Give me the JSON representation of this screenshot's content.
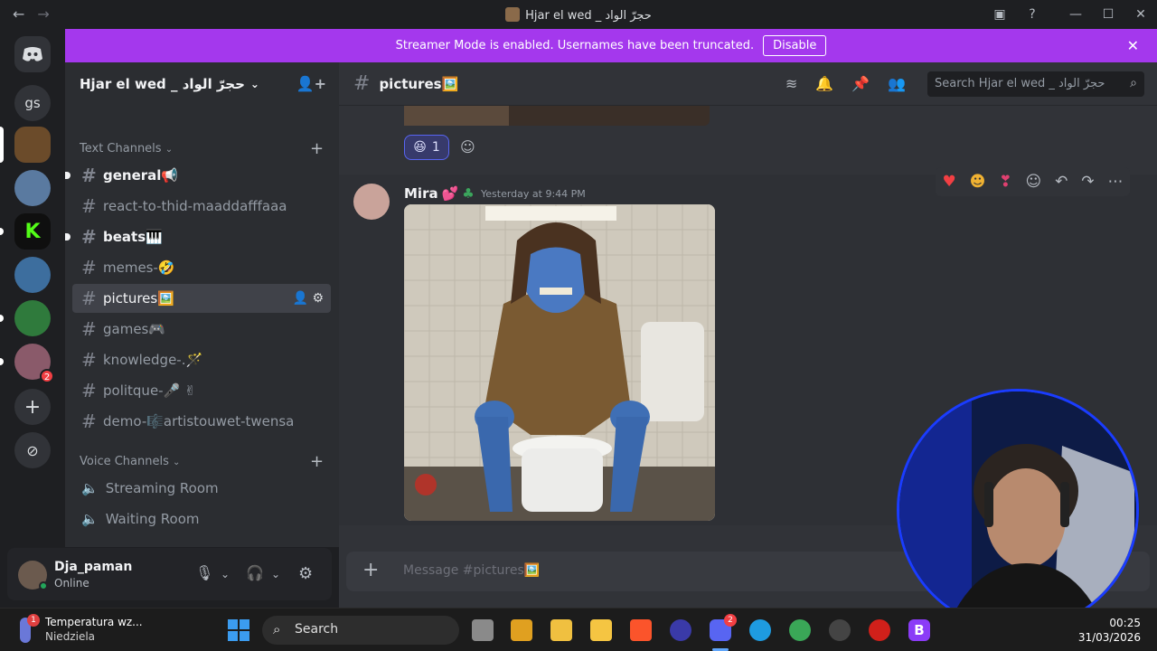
{
  "window": {
    "title": "Hjar el wed _ حجرّ الواد"
  },
  "banner": {
    "text": "Streamer Mode is enabled. Usernames have been truncated.",
    "button": "Disable"
  },
  "guilds": {
    "gs": "gs",
    "badge": "2"
  },
  "server": {
    "name": "Hjar el wed _ حجرّ الواد"
  },
  "categories": {
    "text": "Text Channels",
    "voice": "Voice Channels"
  },
  "channels": [
    {
      "name": "general📢"
    },
    {
      "name": "react-to-thid-maaddafffaaa"
    },
    {
      "name": "beats🎹"
    },
    {
      "name": "memes-🤣"
    },
    {
      "name": "pictures🖼️"
    },
    {
      "name": "games🎮"
    },
    {
      "name": "knowledge-.🪄"
    },
    {
      "name": "politque-🎤 ✌"
    },
    {
      "name": "demo-🎼artistouwet-twensa"
    }
  ],
  "voice_channels": [
    {
      "name": "Streaming Room"
    },
    {
      "name": "Waiting Room"
    }
  ],
  "user": {
    "name": "Dja_paman",
    "status": "Online"
  },
  "channel_header": {
    "name": "pictures🖼️",
    "search_placeholder": "Search Hjar el wed _ حجرّ الواد"
  },
  "reaction": {
    "emoji": "😆",
    "count": "1"
  },
  "message": {
    "author": "Mira",
    "author_emoji": "💕",
    "badge_emoji": "♣",
    "timestamp": "Yesterday at 9:44 PM"
  },
  "composer": {
    "placeholder": "Message #pictures🖼️"
  },
  "taskbar": {
    "weather_title": "Temperatura wz...",
    "weather_sub": "Niedziela",
    "weather_badge": "1",
    "search": "Search",
    "discord_badge": "2",
    "time": "00:25",
    "date": "31/03/2026"
  },
  "colors": {
    "banner": "#a438ed",
    "accent": "#5865f2",
    "online": "#23a55a"
  }
}
